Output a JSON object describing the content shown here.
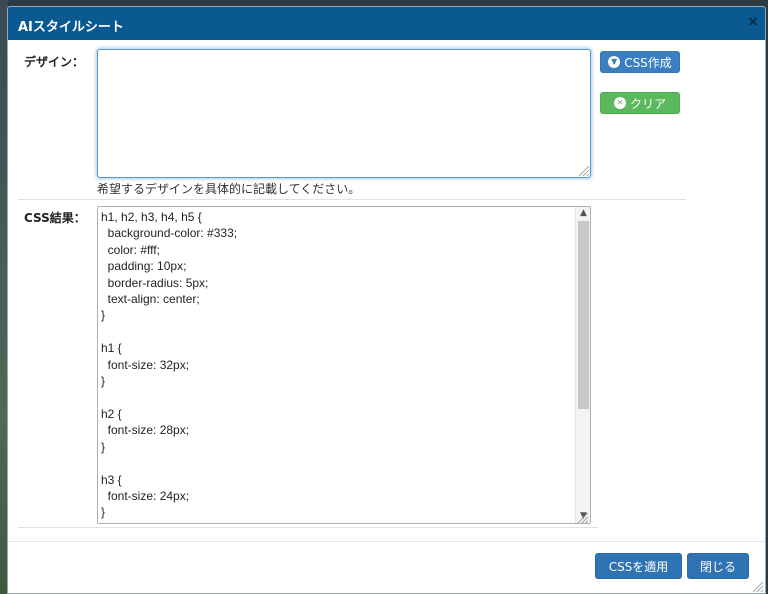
{
  "dialog": {
    "title": "AIスタイルシート",
    "close_label": "×"
  },
  "design": {
    "label": "デザイン：",
    "value": "",
    "help": "希望するデザインを具体的に記載してください。"
  },
  "buttons": {
    "create_css": "CSS作成",
    "clear": "クリア",
    "apply_css": "CSSを適用",
    "close": "閉じる"
  },
  "result": {
    "label": "CSS結果：",
    "lines": [
      "h1, h2, h3, h4, h5 {",
      "  background-color: #333;",
      "  color: #fff;",
      "  padding: 10px;",
      "  border-radius: 5px;",
      "  text-align: center;",
      "}",
      "",
      "h1 {",
      "  font-size: 32px;",
      "}",
      "",
      "h2 {",
      "  font-size: 28px;",
      "}",
      "",
      "h3 {",
      "  font-size: 24px;",
      "}"
    ]
  },
  "scroll": {
    "up_icon": "chevron-up-icon",
    "down_icon": "chevron-down-icon"
  },
  "colors": {
    "titlebar": "#0a5a91",
    "primary_button": "#3a7fc2",
    "clear_button": "#5cb85c",
    "focus_border": "#5b9bd5"
  }
}
